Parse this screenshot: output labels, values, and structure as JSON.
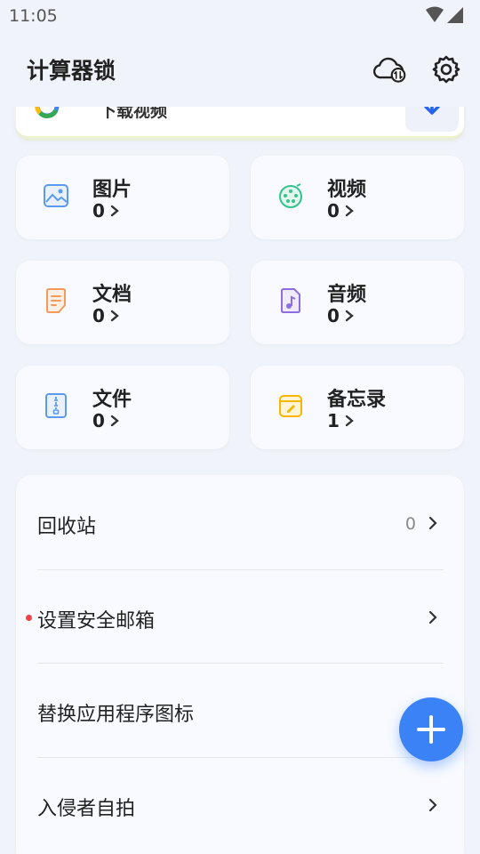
{
  "status_bar": {
    "time": "11:05"
  },
  "header": {
    "title": "计算器锁"
  },
  "search_card": {
    "text": "下载视频"
  },
  "tiles": [
    {
      "label": "图片",
      "count": "0",
      "icon": "image-icon"
    },
    {
      "label": "视频",
      "count": "0",
      "icon": "video-icon"
    },
    {
      "label": "文档",
      "count": "0",
      "icon": "document-icon"
    },
    {
      "label": "音频",
      "count": "0",
      "icon": "audio-icon"
    },
    {
      "label": "文件",
      "count": "0",
      "icon": "file-zip-icon"
    },
    {
      "label": "备忘录",
      "count": "1",
      "icon": "note-icon"
    }
  ],
  "menu": [
    {
      "label": "回收站",
      "count": "0"
    },
    {
      "label": "设置安全邮箱"
    },
    {
      "label": "替换应用程序图标"
    },
    {
      "label": "入侵者自拍"
    }
  ],
  "colors": {
    "accent": "#3b82f6",
    "background": "#f0f3fa",
    "card": "#f8faff",
    "notification_dot": "#ef4444"
  }
}
